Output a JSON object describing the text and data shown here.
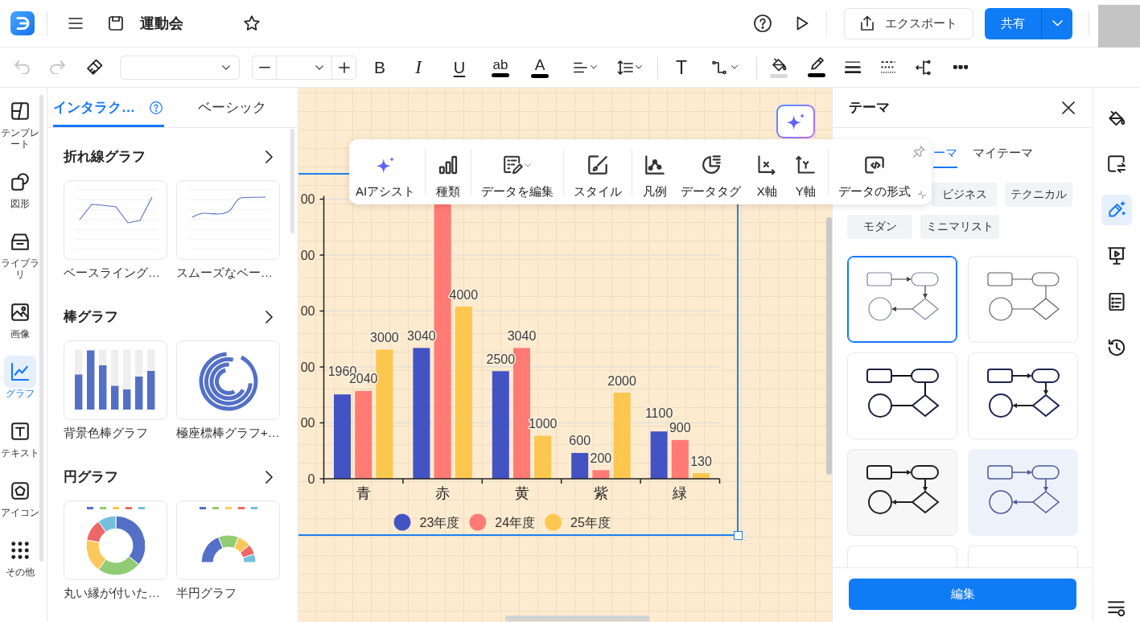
{
  "app_bar": {
    "title": "運動会",
    "starred": false,
    "export_label": "エクスポート",
    "share_label": "共有"
  },
  "format_toolbar": {
    "groups": [
      [
        {
          "kind": "undo",
          "disabled": true
        },
        {
          "kind": "redo",
          "disabled": true
        },
        {
          "kind": "painter",
          "disabled": false
        },
        {
          "kind": "fontfamily",
          "disabled": false
        },
        {
          "kind": "fontsize",
          "disabled": false
        },
        {
          "kind": "bold",
          "label": "B",
          "disabled": false
        },
        {
          "kind": "italic",
          "label": "I",
          "disabled": false
        },
        {
          "kind": "underline",
          "label": "U",
          "disabled": false
        },
        {
          "kind": "highlight",
          "label": "ab",
          "color": "#000000",
          "disabled": false
        },
        {
          "kind": "fontcolor",
          "label": "A",
          "color": "#000000",
          "disabled": false
        },
        {
          "kind": "align",
          "dropdown": true,
          "disabled": false
        },
        {
          "kind": "spacing",
          "dropdown": true,
          "disabled": false
        }
      ],
      [
        {
          "kind": "text",
          "label": "T",
          "disabled": false
        },
        {
          "kind": "connector",
          "dropdown": true,
          "disabled": false
        }
      ],
      [
        {
          "kind": "fill",
          "color": "#d9d9d9",
          "disabled": false
        },
        {
          "kind": "stroke",
          "color": "#000000",
          "disabled": false
        },
        {
          "kind": "weight",
          "disabled": false
        },
        {
          "kind": "dash",
          "disabled": false
        },
        {
          "kind": "arrows",
          "disabled": false
        },
        {
          "kind": "more",
          "disabled": false
        }
      ]
    ]
  },
  "left_rail": {
    "items": [
      {
        "kind": "template",
        "label": "テンプレート",
        "selected": false
      },
      {
        "kind": "shape",
        "label": "図形",
        "selected": false
      },
      {
        "kind": "library",
        "label": "ライブラリ",
        "selected": false
      },
      {
        "kind": "image",
        "label": "画像",
        "selected": false
      },
      {
        "kind": "chart",
        "label": "グラフ",
        "selected": true
      },
      {
        "kind": "text",
        "label": "テキスト",
        "selected": false
      },
      {
        "kind": "icon",
        "label": "アイコン",
        "selected": false
      },
      {
        "kind": "more",
        "label": "その他",
        "selected": false
      }
    ]
  },
  "library_panel": {
    "tabs": [
      {
        "label": "インタラク…",
        "selected": true,
        "help": true
      },
      {
        "label": "ベーシック",
        "selected": false
      }
    ],
    "sections": [
      {
        "title": "折れ線グラフ",
        "items": [
          {
            "kind": "line",
            "label": "ベースライング…"
          },
          {
            "kind": "smooth",
            "label": "スムーズなベー…"
          }
        ]
      },
      {
        "title": "棒グラフ",
        "items": [
          {
            "kind": "bar",
            "label": "背景色棒グラフ"
          },
          {
            "kind": "polar",
            "label": "極座標棒グラフ+…"
          }
        ]
      },
      {
        "title": "円グラフ",
        "items": [
          {
            "kind": "donut",
            "label": "丸い縁が付いた…"
          },
          {
            "kind": "halfdonut",
            "label": "半円グラフ"
          }
        ]
      }
    ]
  },
  "canvas": {
    "chart_selected": true,
    "y_tick_labels": [
      "00",
      "00",
      "00",
      "00",
      "00",
      "0"
    ],
    "chart_data": {
      "type": "bar",
      "categories": [
        "青",
        "赤",
        "黄",
        "紫",
        "緑"
      ],
      "series": [
        {
          "name": "23年度",
          "color": "#4353c4",
          "values": [
            1960,
            3040,
            2500,
            600,
            1100
          ],
          "value_labels": [
            "1960",
            "3040",
            "2500",
            "600",
            "1100"
          ]
        },
        {
          "name": "24年度",
          "color": "#ff7b73",
          "values": [
            2040,
            6400,
            3040,
            200,
            900
          ],
          "value_labels": [
            "2040",
            null,
            "3040",
            "200",
            "900"
          ]
        },
        {
          "name": "25年度",
          "color": "#fcc74f",
          "values": [
            3000,
            4000,
            1000,
            2000,
            130
          ],
          "value_labels": [
            "3000",
            "4000",
            "1000",
            "2000",
            "130"
          ]
        }
      ],
      "legend": "bottom"
    }
  },
  "chart_toolbar": {
    "groups": [
      [
        {
          "kind": "ai",
          "label": "AIアシスト"
        }
      ],
      [
        {
          "kind": "type",
          "label": "種類"
        }
      ],
      [
        {
          "kind": "edit",
          "label": "データを編集",
          "dropdown": true
        }
      ],
      [
        {
          "kind": "style",
          "label": "スタイル"
        }
      ],
      [
        {
          "kind": "legend",
          "label": "凡例"
        },
        {
          "kind": "tag",
          "label": "データタグ"
        },
        {
          "kind": "xaxis",
          "label": "X軸"
        },
        {
          "kind": "yaxis",
          "label": "Y軸"
        }
      ],
      [
        {
          "kind": "format",
          "label": "データの形式"
        }
      ]
    ]
  },
  "theme_panel": {
    "title": "テーマ",
    "tabs": [
      {
        "label": "ーマ",
        "selected": true
      },
      {
        "label": "マイテーマ",
        "selected": false
      }
    ],
    "chips": [
      {
        "label": "ビジネス"
      },
      {
        "label": "テクニカル"
      },
      {
        "label": "モダン"
      },
      {
        "label": "ミニマリスト"
      }
    ],
    "themes": [
      {
        "kind": "soft",
        "selected": true
      },
      {
        "kind": "plain",
        "selected": false
      },
      {
        "kind": "bold",
        "selected": false
      },
      {
        "kind": "navy",
        "selected": false
      },
      {
        "kind": "heavy",
        "selected": false
      },
      {
        "kind": "blue",
        "selected": false
      },
      {
        "kind": "peek",
        "selected": false
      },
      {
        "kind": "peek",
        "selected": false
      }
    ],
    "button": "編集"
  },
  "right_rail": {
    "items": [
      {
        "kind": "fill",
        "selected": false
      },
      {
        "kind": "replace",
        "selected": false
      },
      {
        "kind": "theme",
        "selected": true
      },
      {
        "kind": "present",
        "selected": false
      },
      {
        "kind": "outline",
        "selected": false
      },
      {
        "kind": "history",
        "selected": false
      }
    ],
    "footer_items": [
      {
        "kind": "settings"
      }
    ]
  }
}
